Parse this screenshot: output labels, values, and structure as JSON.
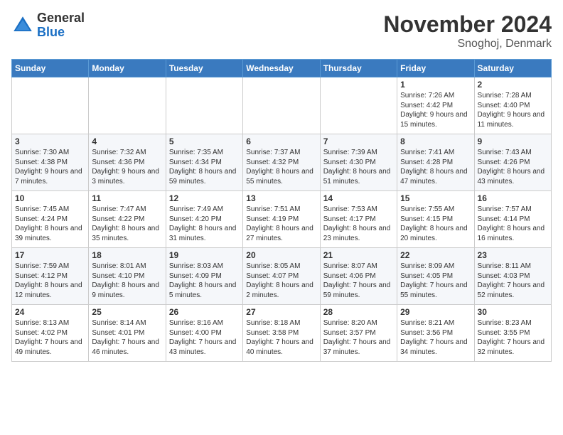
{
  "header": {
    "logo_general": "General",
    "logo_blue": "Blue",
    "month_title": "November 2024",
    "location": "Snoghoj, Denmark"
  },
  "days_of_week": [
    "Sunday",
    "Monday",
    "Tuesday",
    "Wednesday",
    "Thursday",
    "Friday",
    "Saturday"
  ],
  "weeks": [
    [
      {
        "day": "",
        "info": ""
      },
      {
        "day": "",
        "info": ""
      },
      {
        "day": "",
        "info": ""
      },
      {
        "day": "",
        "info": ""
      },
      {
        "day": "",
        "info": ""
      },
      {
        "day": "1",
        "info": "Sunrise: 7:26 AM\nSunset: 4:42 PM\nDaylight: 9 hours and 15 minutes."
      },
      {
        "day": "2",
        "info": "Sunrise: 7:28 AM\nSunset: 4:40 PM\nDaylight: 9 hours and 11 minutes."
      }
    ],
    [
      {
        "day": "3",
        "info": "Sunrise: 7:30 AM\nSunset: 4:38 PM\nDaylight: 9 hours and 7 minutes."
      },
      {
        "day": "4",
        "info": "Sunrise: 7:32 AM\nSunset: 4:36 PM\nDaylight: 9 hours and 3 minutes."
      },
      {
        "day": "5",
        "info": "Sunrise: 7:35 AM\nSunset: 4:34 PM\nDaylight: 8 hours and 59 minutes."
      },
      {
        "day": "6",
        "info": "Sunrise: 7:37 AM\nSunset: 4:32 PM\nDaylight: 8 hours and 55 minutes."
      },
      {
        "day": "7",
        "info": "Sunrise: 7:39 AM\nSunset: 4:30 PM\nDaylight: 8 hours and 51 minutes."
      },
      {
        "day": "8",
        "info": "Sunrise: 7:41 AM\nSunset: 4:28 PM\nDaylight: 8 hours and 47 minutes."
      },
      {
        "day": "9",
        "info": "Sunrise: 7:43 AM\nSunset: 4:26 PM\nDaylight: 8 hours and 43 minutes."
      }
    ],
    [
      {
        "day": "10",
        "info": "Sunrise: 7:45 AM\nSunset: 4:24 PM\nDaylight: 8 hours and 39 minutes."
      },
      {
        "day": "11",
        "info": "Sunrise: 7:47 AM\nSunset: 4:22 PM\nDaylight: 8 hours and 35 minutes."
      },
      {
        "day": "12",
        "info": "Sunrise: 7:49 AM\nSunset: 4:20 PM\nDaylight: 8 hours and 31 minutes."
      },
      {
        "day": "13",
        "info": "Sunrise: 7:51 AM\nSunset: 4:19 PM\nDaylight: 8 hours and 27 minutes."
      },
      {
        "day": "14",
        "info": "Sunrise: 7:53 AM\nSunset: 4:17 PM\nDaylight: 8 hours and 23 minutes."
      },
      {
        "day": "15",
        "info": "Sunrise: 7:55 AM\nSunset: 4:15 PM\nDaylight: 8 hours and 20 minutes."
      },
      {
        "day": "16",
        "info": "Sunrise: 7:57 AM\nSunset: 4:14 PM\nDaylight: 8 hours and 16 minutes."
      }
    ],
    [
      {
        "day": "17",
        "info": "Sunrise: 7:59 AM\nSunset: 4:12 PM\nDaylight: 8 hours and 12 minutes."
      },
      {
        "day": "18",
        "info": "Sunrise: 8:01 AM\nSunset: 4:10 PM\nDaylight: 8 hours and 9 minutes."
      },
      {
        "day": "19",
        "info": "Sunrise: 8:03 AM\nSunset: 4:09 PM\nDaylight: 8 hours and 5 minutes."
      },
      {
        "day": "20",
        "info": "Sunrise: 8:05 AM\nSunset: 4:07 PM\nDaylight: 8 hours and 2 minutes."
      },
      {
        "day": "21",
        "info": "Sunrise: 8:07 AM\nSunset: 4:06 PM\nDaylight: 7 hours and 59 minutes."
      },
      {
        "day": "22",
        "info": "Sunrise: 8:09 AM\nSunset: 4:05 PM\nDaylight: 7 hours and 55 minutes."
      },
      {
        "day": "23",
        "info": "Sunrise: 8:11 AM\nSunset: 4:03 PM\nDaylight: 7 hours and 52 minutes."
      }
    ],
    [
      {
        "day": "24",
        "info": "Sunrise: 8:13 AM\nSunset: 4:02 PM\nDaylight: 7 hours and 49 minutes."
      },
      {
        "day": "25",
        "info": "Sunrise: 8:14 AM\nSunset: 4:01 PM\nDaylight: 7 hours and 46 minutes."
      },
      {
        "day": "26",
        "info": "Sunrise: 8:16 AM\nSunset: 4:00 PM\nDaylight: 7 hours and 43 minutes."
      },
      {
        "day": "27",
        "info": "Sunrise: 8:18 AM\nSunset: 3:58 PM\nDaylight: 7 hours and 40 minutes."
      },
      {
        "day": "28",
        "info": "Sunrise: 8:20 AM\nSunset: 3:57 PM\nDaylight: 7 hours and 37 minutes."
      },
      {
        "day": "29",
        "info": "Sunrise: 8:21 AM\nSunset: 3:56 PM\nDaylight: 7 hours and 34 minutes."
      },
      {
        "day": "30",
        "info": "Sunrise: 8:23 AM\nSunset: 3:55 PM\nDaylight: 7 hours and 32 minutes."
      }
    ]
  ]
}
